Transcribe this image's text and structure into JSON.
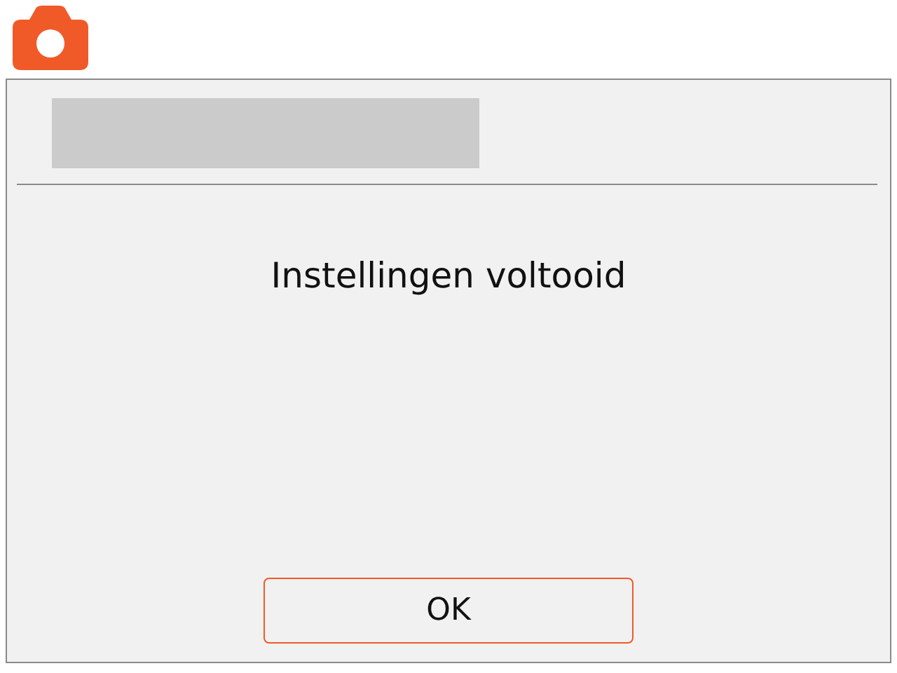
{
  "dialog": {
    "message": "Instellingen voltooid",
    "buttons": [
      "OK"
    ]
  }
}
